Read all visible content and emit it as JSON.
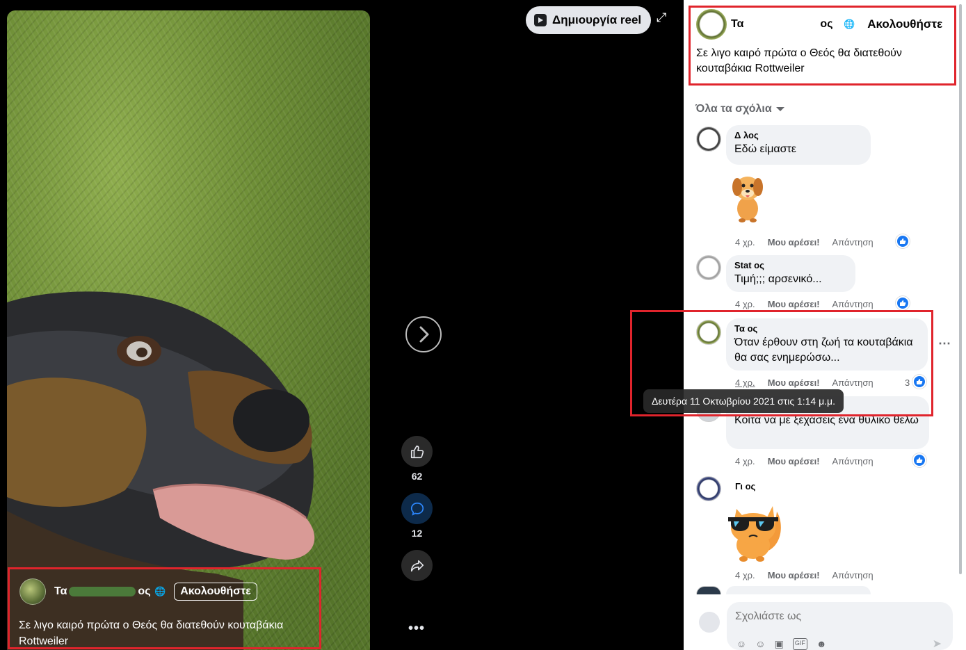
{
  "reel_button": {
    "label": "Δημιουργία reel"
  },
  "video": {
    "owner_name": "Τα",
    "owner_name_suffix": "ος",
    "follow_label": "Ακολουθήστε",
    "caption": "Σε λιγο καιρό πρώτα ο Θεός θα διατεθούν κουταβάκια Rottweiler"
  },
  "actions": {
    "likes": "62",
    "comments": "12"
  },
  "post": {
    "author": "Τα",
    "author_suffix": "ος",
    "follow_label": "Ακολουθήστε",
    "text": "Σε λιγο καιρό πρώτα ο Θεός θα διατεθούν κουταβάκια Rottweiler"
  },
  "comments_sort": "Όλα τα σχόλια",
  "comments": [
    {
      "name": "Δ                    λος",
      "text": "Εδώ είμαστε",
      "time": "4 χρ.",
      "like": "Μου αρέσει!",
      "reply": "Απάντηση"
    },
    {
      "name": "Stat             ος",
      "text": "Τιμή;;; αρσενικό...",
      "time": "4 χρ.",
      "like": "Μου αρέσει!",
      "reply": "Απάντηση"
    },
    {
      "name": "Τα              ος",
      "text": "Όταν έρθουν στη ζωή τα κουταβάκια θα σας ενημερώσω...",
      "time": "4 χρ.",
      "like": "Μου αρέσει!",
      "reply": "Απάντηση",
      "reactions": "3"
    },
    {
      "name": "",
      "text": "Κοίτα να με ξεχάσεις ένα θυλικο θελω",
      "time": "4 χρ.",
      "like": "Μου αρέσει!",
      "reply": "Απάντηση"
    },
    {
      "name": "Γι              ος",
      "text": "",
      "time": "4 χρ.",
      "like": "Μου αρέσει!",
      "reply": "Απάντηση"
    }
  ],
  "tooltip": "Δευτέρα 11 Οκτωβρίου 2021 στις 1:14 μ.μ.",
  "composer": {
    "placeholder": "Σχολιάστε ως"
  },
  "colors": {
    "accent": "#1877f2",
    "highlight": "#e0242c"
  }
}
